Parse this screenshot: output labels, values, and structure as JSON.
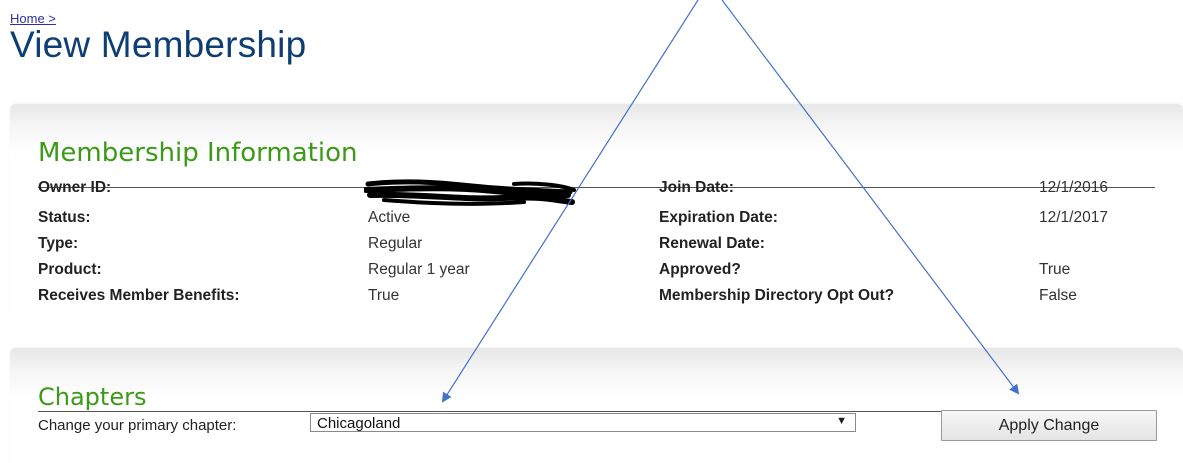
{
  "breadcrumb": {
    "home": "Home >"
  },
  "page": {
    "title": "View Membership"
  },
  "membership": {
    "title": "Membership Information",
    "left": [
      {
        "label": "Owner ID:",
        "value": ""
      },
      {
        "label": "Status:",
        "value": "Active"
      },
      {
        "label": "Type:",
        "value": "Regular"
      },
      {
        "label": "Product:",
        "value": "Regular 1 year"
      },
      {
        "label": "Receives Member Benefits:",
        "value": "True"
      }
    ],
    "right": [
      {
        "label": "Join Date:",
        "value": "12/1/2016"
      },
      {
        "label": "Expiration Date:",
        "value": "12/1/2017"
      },
      {
        "label": "Renewal Date:",
        "value": ""
      },
      {
        "label": "Approved?",
        "value": "True"
      },
      {
        "label": "Membership Directory Opt Out?",
        "value": "False"
      }
    ]
  },
  "chapters": {
    "title": "Chapters",
    "change_label": "Change your primary chapter:",
    "selected": "Chicagoland",
    "dropdown_arrow": "▼",
    "apply_label": "Apply Change"
  },
  "colors": {
    "title": "#0f3e73",
    "section_heading": "#3b9a17",
    "annotation_arrow": "#4472c4"
  },
  "icons": {
    "redaction": "redaction-scribble-icon",
    "annotation": "annotation-arrow"
  }
}
